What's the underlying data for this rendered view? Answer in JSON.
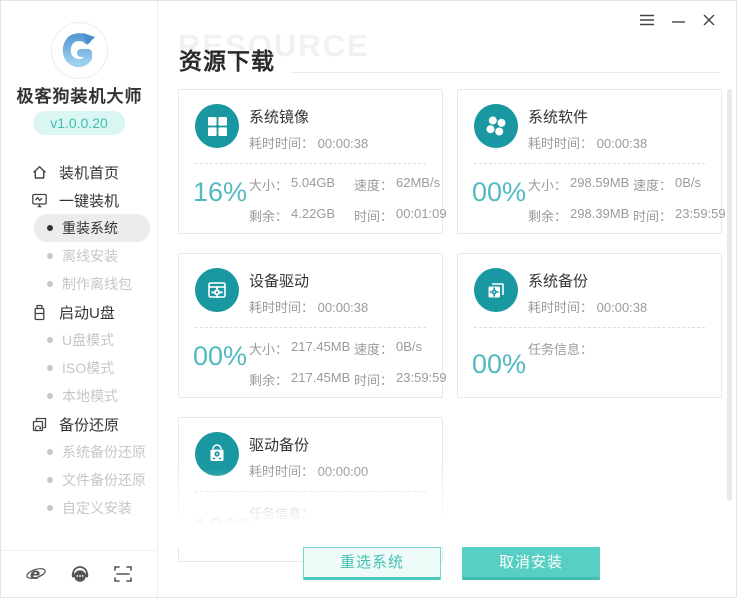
{
  "colors": {
    "accent_teal": "#1a98a1",
    "percent_teal": "#54bac2",
    "button_teal": "#57cfc4",
    "button_edge": "#41bdb1",
    "version_pill_bg": "#d9f6f3",
    "version_pill_text": "#43bdb2",
    "active_item_bg": "#ececec",
    "disabled_text": "#c3c7cb",
    "label_gray": "#9b9b9b"
  },
  "window": {
    "controls": [
      {
        "name": "menu",
        "icon": "hamburger-icon"
      },
      {
        "name": "minimize",
        "icon": "minimize-icon"
      },
      {
        "name": "close",
        "icon": "close-icon"
      }
    ]
  },
  "sidebar": {
    "app_name": "极客狗装机大师",
    "version": "v1.0.0.20",
    "items": [
      {
        "label": "装机首页",
        "type": "parent",
        "icon": "home-icon"
      },
      {
        "label": "一键装机",
        "type": "parent",
        "icon": "monitor-icon"
      },
      {
        "label": "重装系统",
        "type": "sub",
        "active": true
      },
      {
        "label": "离线安装",
        "type": "sub"
      },
      {
        "label": "制作离线包",
        "type": "sub"
      },
      {
        "label": "启动U盘",
        "type": "parent",
        "icon": "usb-icon"
      },
      {
        "label": "U盘模式",
        "type": "sub"
      },
      {
        "label": "ISO模式",
        "type": "sub"
      },
      {
        "label": "本地模式",
        "type": "sub"
      },
      {
        "label": "备份还原",
        "type": "parent",
        "icon": "restore-icon"
      },
      {
        "label": "系统备份还原",
        "type": "sub"
      },
      {
        "label": "文件备份还原",
        "type": "sub"
      },
      {
        "label": "自定义安装",
        "type": "sub"
      }
    ],
    "footer_icons": [
      "ie-browser-icon",
      "support-headset-icon",
      "scan-icon"
    ]
  },
  "header": {
    "title": "资源下载",
    "watermark": "RESOURCE"
  },
  "cards": [
    {
      "title": "系统镜像",
      "icon": "windows-grid-icon",
      "elapsed_label": "耗时时间：",
      "elapsed_value": "00:00:38",
      "percent": "16%",
      "size_label": "大小：",
      "size_value": "5.04GB",
      "speed_label": "速度：",
      "speed_value": "62MB/s",
      "remain_label": "剩余：",
      "remain_value": "4.22GB",
      "time_label": "时间：",
      "time_value": "00:01:09"
    },
    {
      "title": "系统软件",
      "icon": "app-petals-icon",
      "elapsed_label": "耗时时间：",
      "elapsed_value": "00:00:38",
      "percent": "00%",
      "size_label": "大小：",
      "size_value": "298.59MB",
      "speed_label": "速度：",
      "speed_value": "0B/s",
      "remain_label": "剩余：",
      "remain_value": "298.39MB",
      "time_label": "时间：",
      "time_value": "23:59:59"
    },
    {
      "title": "设备驱动",
      "icon": "driver-gear-box-icon",
      "elapsed_label": "耗时时间：",
      "elapsed_value": "00:00:38",
      "percent": "00%",
      "size_label": "大小：",
      "size_value": "217.45MB",
      "speed_label": "速度：",
      "speed_value": "0B/s",
      "remain_label": "剩余：",
      "remain_value": "217.45MB",
      "time_label": "时间：",
      "time_value": "23:59:59"
    },
    {
      "title": "系统备份",
      "icon": "backup-gear-icon",
      "elapsed_label": "耗时时间：",
      "elapsed_value": "00:00:38",
      "percent": "00%",
      "task_label": "任务信息："
    },
    {
      "title": "驱动备份",
      "icon": "hard-drive-icon",
      "elapsed_label": "耗时时间：",
      "elapsed_value": "00:00:00",
      "percent": "100%",
      "task_label": "任务信息："
    }
  ],
  "footer_buttons": {
    "reselect": "重选系统",
    "cancel": "取消安装"
  }
}
